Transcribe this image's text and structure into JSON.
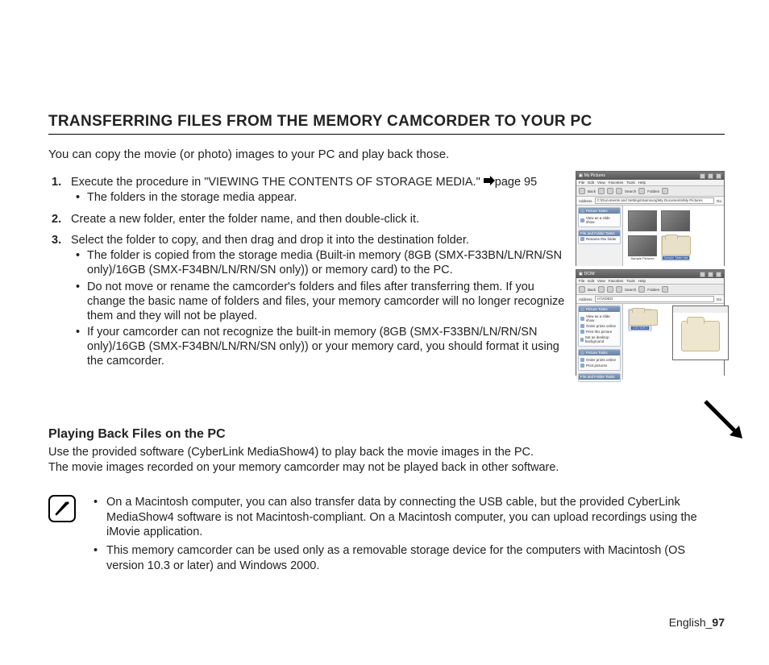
{
  "heading": "TRANSFERRING FILES FROM THE MEMORY CAMCORDER TO YOUR PC",
  "intro": "You can copy the movie (or photo) images to your PC and play back those.",
  "steps": [
    {
      "num": "1.",
      "text": "Execute the procedure in \"VIEWING THE CONTENTS OF STORAGE MEDIA.\" ",
      "pageref": "page 95",
      "sub": [
        "The folders in the storage media appear."
      ]
    },
    {
      "num": "2.",
      "text": "Create a new folder, enter the folder name, and then double-click it.",
      "sub": []
    },
    {
      "num": "3.",
      "text": "Select the folder to copy, and then drag and drop it into the destination folder.",
      "sub": [
        "The folder is copied from the storage media (Built-in memory (8GB (SMX-F33BN/LN/RN/SN only)/16GB (SMX-F34BN/LN/RN/SN only)) or memory card) to the PC.",
        "Do not move or rename the camcorder's folders and files after transferring them. If you change the basic name of folders and files, your memory camcorder will no longer recognize them and they will not be played.",
        "If your camcorder can not recognize the built-in memory (8GB (SMX-F33BN/LN/RN/SN only)/16GB (SMX-F34BN/LN/RN/SN only)) or your memory card, you should format it using the camcorder."
      ]
    }
  ],
  "subheading": "Playing Back Files on the PC",
  "para1": "Use the provided software (CyberLink MediaShow4) to play back the movie images in the PC.",
  "para2": "The movie images recorded on your memory camcorder may not be played back in other software.",
  "notes": [
    "On a Macintosh computer, you can also transfer data by connecting the USB cable, but the provided CyberLink MediaShow4 software is not Macintosh-compliant. On a Macintosh computer, you can upload recordings using the iMovie application.",
    "This memory camcorder can be used only as a removable storage device for the computers with Macintosh (OS version 10.3 or later) and Windows 2000."
  ],
  "footer": {
    "lang": "English",
    "sep": "_",
    "page": "97"
  },
  "fig": {
    "win1": {
      "title": "My Pictures",
      "menu": [
        "File",
        "Edit",
        "View",
        "Favorites",
        "Tools",
        "Help"
      ],
      "tool": [
        "Back",
        "",
        "",
        "Search",
        "Folders"
      ],
      "addr_label": "Address",
      "addr": "C:\\Documents and Settings\\Samsung\\My Documents\\My Pictures",
      "go": "Go",
      "side_hd": "Picture Tasks",
      "side_items": [
        "View as a slide show"
      ],
      "side_hd2": "File and Folder Tasks",
      "side_items2": [
        "Rename this folder"
      ],
      "thumbs": [
        {
          "type": "img",
          "label": ""
        },
        {
          "type": "img",
          "label": ""
        },
        {
          "type": "img",
          "label": "Sample Pictures"
        },
        {
          "type": "fld",
          "label": "Sample Materials",
          "sel": true
        }
      ]
    },
    "win2": {
      "title": "DCIM",
      "menu": [
        "File",
        "Edit",
        "View",
        "Favorites",
        "Tools",
        "Help"
      ],
      "tool": [
        "Back",
        "",
        "",
        "Search",
        "Folders"
      ],
      "addr_label": "Address",
      "addr": "H:\\VIDEO",
      "go": "Go",
      "side_hd": "Picture Tasks",
      "side_items": [
        "View as a slide show",
        "Order prints online",
        "Print this picture",
        "Set as desktop background"
      ],
      "side_hd2": "Picture Tasks",
      "side_items2": [
        "Order prints online",
        "Print pictures"
      ],
      "side_hd3": "File and Folder Tasks",
      "thumb": {
        "label": "100VIDEO"
      }
    }
  }
}
